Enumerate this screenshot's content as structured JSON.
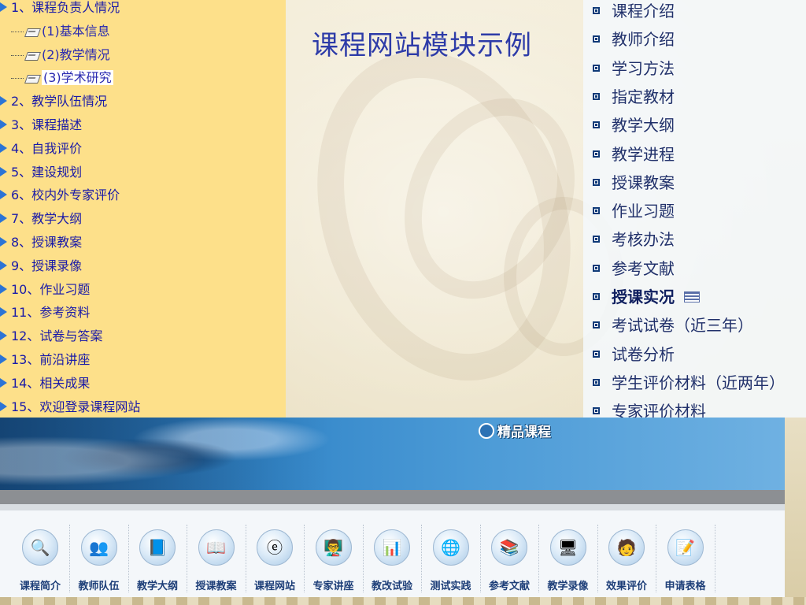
{
  "slide": {
    "title": "课程网站模块示例"
  },
  "left_tree": {
    "items": [
      {
        "label": "1、课程负责人情况",
        "level": 0
      },
      {
        "label": "(1)基本信息",
        "level": 1
      },
      {
        "label": "(2)教学情况",
        "level": 1
      },
      {
        "label": "(3)学术研究",
        "level": 1,
        "highlighted": true
      },
      {
        "label": "2、教学队伍情况",
        "level": 0
      },
      {
        "label": "3、课程描述",
        "level": 0
      },
      {
        "label": "4、自我评价",
        "level": 0
      },
      {
        "label": "5、建设规划",
        "level": 0
      },
      {
        "label": "6、校内外专家评价",
        "level": 0
      },
      {
        "label": "7、教学大纲",
        "level": 0
      },
      {
        "label": "8、授课教案",
        "level": 0
      },
      {
        "label": "9、授课录像",
        "level": 0
      },
      {
        "label": "10、作业习题",
        "level": 0
      },
      {
        "label": "11、参考资料",
        "level": 0
      },
      {
        "label": "12、试卷与答案",
        "level": 0
      },
      {
        "label": "13、前沿讲座",
        "level": 0
      },
      {
        "label": "14、相关成果",
        "level": 0
      },
      {
        "label": "15、欢迎登录课程网站",
        "level": 0
      }
    ]
  },
  "right_menu": {
    "items": [
      {
        "label": "课程介绍"
      },
      {
        "label": "教师介绍"
      },
      {
        "label": "学习方法"
      },
      {
        "label": "指定教材"
      },
      {
        "label": "教学大纲"
      },
      {
        "label": "教学进程"
      },
      {
        "label": "授课教案"
      },
      {
        "label": "作业习题"
      },
      {
        "label": "考核办法"
      },
      {
        "label": "参考文献"
      },
      {
        "label": "授课实况",
        "bold": true
      },
      {
        "label": "考试试卷（近三年）"
      },
      {
        "label": "试卷分析"
      },
      {
        "label": "学生评价材料（近两年）"
      },
      {
        "label": "专家评价材料"
      }
    ]
  },
  "banner": {
    "brand": "精品课程",
    "nav": [
      {
        "label": "课程简介",
        "icon": "magnifier-icon",
        "glyph": "🔍"
      },
      {
        "label": "教师队伍",
        "icon": "people-icon",
        "glyph": "👥"
      },
      {
        "label": "教学大纲",
        "icon": "notebook-icon",
        "glyph": "📘"
      },
      {
        "label": "授课教案",
        "icon": "open-book-icon",
        "glyph": "📖"
      },
      {
        "label": "课程网站",
        "icon": "ie-browser-icon",
        "glyph": "ⓔ"
      },
      {
        "label": "专家讲座",
        "icon": "lecturer-icon",
        "glyph": "👨‍🏫"
      },
      {
        "label": "教改试验",
        "icon": "chart-icon",
        "glyph": "📊"
      },
      {
        "label": "测试实践",
        "icon": "globe-icon",
        "glyph": "🌐"
      },
      {
        "label": "参考文献",
        "icon": "books-stack-icon",
        "glyph": "📚"
      },
      {
        "label": "教学录像",
        "icon": "monitor-icon",
        "glyph": "🖥"
      },
      {
        "label": "效果评价",
        "icon": "user-badge-icon",
        "glyph": "🧑"
      },
      {
        "label": "申请表格",
        "icon": "form-pen-icon",
        "glyph": "📝"
      }
    ]
  }
}
